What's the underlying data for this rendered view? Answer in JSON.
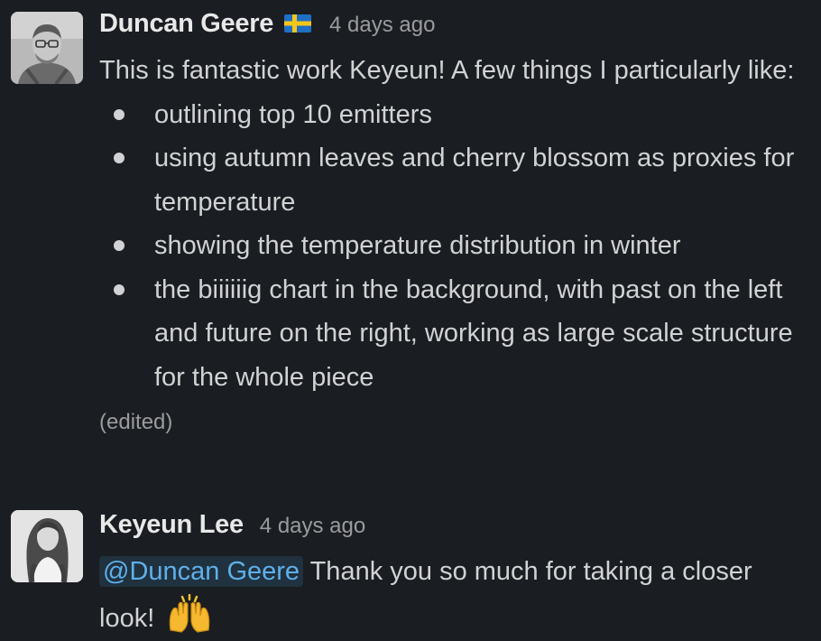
{
  "messages": [
    {
      "author": "Duncan Geere",
      "flag": "flag-sweden-icon",
      "timestamp": "4 days ago",
      "intro": "This is fantastic work Keyeun! A few things I particularly like:",
      "bullets": [
        "outlining top 10 emitters",
        "using autumn leaves and cherry blossom as proxies for temperature",
        "showing the temperature distribution in winter",
        "the biiiiiig chart in the background, with past on the left and future on the right, working as large scale structure for the whole piece"
      ],
      "edited": "(edited)"
    },
    {
      "author": "Keyeun Lee",
      "timestamp": "4 days ago",
      "mention": "@Duncan Geere",
      "text": " Thank you so much for taking a closer look! ",
      "emoji": "raising-hands-icon"
    }
  ]
}
